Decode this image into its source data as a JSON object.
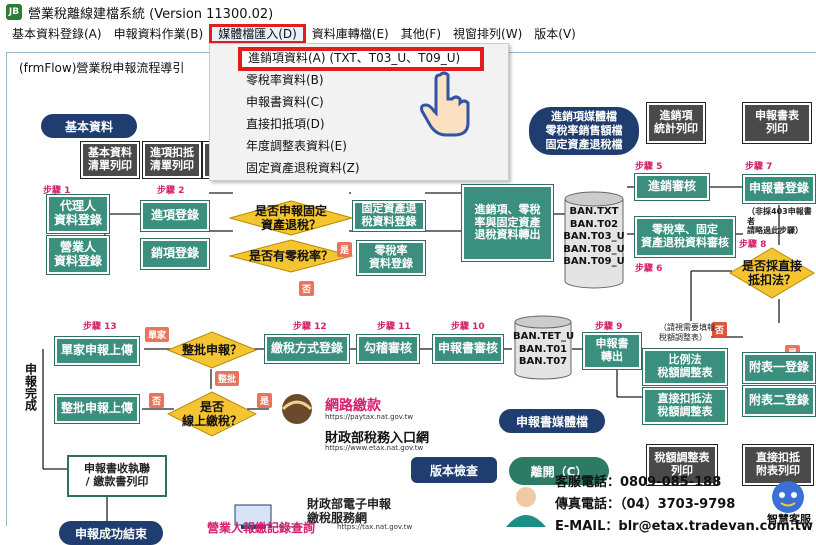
{
  "app": {
    "icon_text": "JB",
    "title": "營業稅離線建檔系統 (Version 11300.02)"
  },
  "menu": {
    "items": [
      "基本資料登錄(A)",
      "申報資料作業(B)",
      "媒體檔匯入(D)",
      "資料庫轉檔(E)",
      "其他(F)",
      "視窗排列(W)",
      "版本(V)"
    ]
  },
  "dropdown": {
    "items": [
      "進銷項資料(A) (TXT、T03_U、T09_U)",
      "零稅率資料(B)",
      "申報書資料(C)",
      "直接扣抵項(D)",
      "年度調整表資料(E)",
      "固定資產退稅資料(Z)"
    ]
  },
  "frame": {
    "title": "(frmFlow)營業稅申報流程導引"
  },
  "flow": {
    "basic_data": "基本資料",
    "basic_list": "基本資料\n清單列印",
    "deduct_list": "進項扣抵\n清單列印",
    "step1": "步驟 1",
    "step2": "步驟 2",
    "step5": "步驟 5",
    "step7": "步驟 7",
    "step8": "步驟 8",
    "step6": "步驟 6",
    "step9": "步驟 9",
    "step10": "步驟 10",
    "step11": "步驟 11",
    "step12": "步驟 12",
    "step13": "步驟 13",
    "agent_entry": "代理人\n資料登錄",
    "biz_entry": "營業人\n資料登錄",
    "purchase_entry": "進項登錄",
    "sales_entry": "銷項登錄",
    "q_fixed_asset": "是否申報固定\n資產退稅？",
    "q_zero_rate": "是否有零稅率？",
    "fixed_refund_entry": "固定資產退\n稅資料登錄",
    "zero_rate_entry": "零稅率\n資料登錄",
    "convert": "進銷項、零稅\n率與固定資產\n退稅資料轉出",
    "ban_files": "BAN.TXT\nBAN.T02\nBAN.T03_U\nBAN.T08_U\nBAN.T09_U",
    "media_archive": "進銷項媒體檔\n零稅率銷售額檔\n固定資產退稅檔",
    "sales_print": "進銷項\n統計列印",
    "sales_audit": "進銷審核",
    "zero_fixed_audit": "零稅率、固定\n資產退稅資料審核",
    "report_print": "申報書表\n列印",
    "report_entry": "申報書登錄",
    "note_403": "（非採403申報書者\n請略過此步驟）",
    "q_direct": "是否採直接\n抵扣法？",
    "yes": "是",
    "no": "否",
    "note_adjust": "（請視需要填報\n稅額調整表）",
    "ratio_adjust": "比例法\n稅額調整表",
    "direct_adjust": "直接扣抵法\n稅額調整表",
    "att1": "附表一登錄",
    "att2": "附表二登錄",
    "adjust_print": "稅額調整表\n列印",
    "direct_att_print": "直接扣抵\n附表列印",
    "report_out": "申報書\n轉出",
    "ban_tet": "BAN.TET_U\nBAN.T01\nBAN.T07",
    "report_audit": "申報書審核",
    "check_audit": "勾稽審核",
    "pay_entry": "繳稅方式登錄",
    "q_batch": "整批申報？",
    "single": "單家",
    "batch": "整批",
    "single_upload": "單家申報上傳",
    "batch_upload": "整批申報上傳",
    "q_online": "是否\n線上繳稅？",
    "report_media": "申報書媒體檔",
    "side_done": "申報完成",
    "receipt_print": "申報書收執聯\n/ 繳款書列印",
    "done": "申報成功結束",
    "version_check": "版本檢查",
    "leave": "離開（C）",
    "paytax": "網路繳款",
    "paytax_url": "https://paytax.nat.gov.tw",
    "mof_portal": "財政部稅務入口網",
    "mof_url": "https://www.etax.nat.gov.tw",
    "efile": "財政部電子申報\n繳稅服務網",
    "efile_url": "https://tax.nat.gov.tw",
    "bottom_cut": "營業人報繳記錄查詢",
    "service_phone": "客服電話：0809-085-188",
    "fax": "傳真電話：（04）3703-9798",
    "email": "E-MAIL：blr@etax.tradevan.com.tw",
    "smart_service": "智慧客服"
  },
  "colors": {
    "accent": "#3b8f7e",
    "highlight": "#e41c1c",
    "navy": "#1f3d6e"
  }
}
